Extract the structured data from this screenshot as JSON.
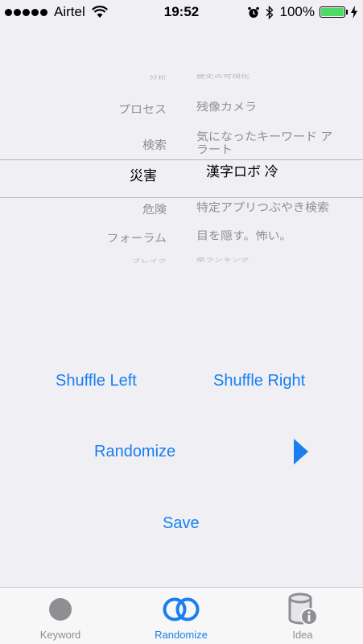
{
  "status_bar": {
    "carrier": "Airtel",
    "time": "19:52",
    "battery_percent": "100%",
    "battery_level": 1.0
  },
  "picker": {
    "rows": [
      {
        "left": "分析",
        "right": "歴史の可視化"
      },
      {
        "left": "プロセス",
        "right": "残像カメラ"
      },
      {
        "left": "検索",
        "right": "気になったキーワード アラート"
      },
      {
        "left": "災害",
        "right": "漢字ロボ 冷"
      },
      {
        "left": "危険",
        "right": "特定アプリつぶやき検索"
      },
      {
        "left": "フォーラム",
        "right": "目を隠す。怖い。"
      },
      {
        "left": "ブレイク",
        "right": "県ランキング"
      }
    ]
  },
  "buttons": {
    "shuffle_left": "Shuffle Left",
    "shuffle_right": "Shuffle Right",
    "randomize": "Randomize",
    "save": "Save"
  },
  "tab_bar": {
    "tabs": [
      {
        "label": "Keyword",
        "icon": "circle-icon"
      },
      {
        "label": "Randomize",
        "icon": "double-ring-icon"
      },
      {
        "label": "Idea",
        "icon": "database-info-icon"
      }
    ],
    "active_index": 1
  },
  "colors": {
    "accent": "#1a7ef0",
    "inactive": "#8e8e93",
    "battery": "#4cd964"
  }
}
